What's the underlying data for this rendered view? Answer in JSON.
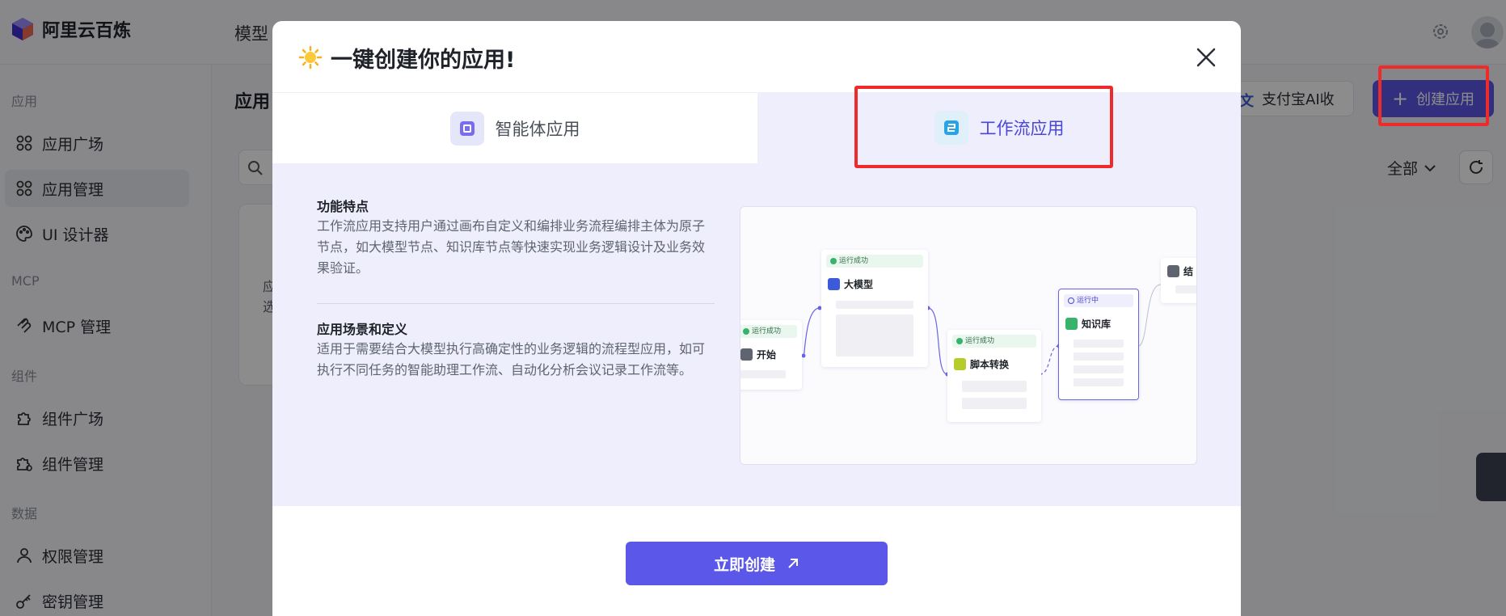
{
  "brand": {
    "name": "阿里云百炼"
  },
  "topnav": {
    "first": "模型"
  },
  "sidebar": {
    "groups": [
      "应用",
      "MCP",
      "组件",
      "数据"
    ],
    "items": [
      {
        "label": "应用广场",
        "icon": "grid-icon"
      },
      {
        "label": "应用管理",
        "icon": "grid-icon"
      },
      {
        "label": "UI 设计器",
        "icon": "palette-icon"
      },
      {
        "label": "MCP 管理",
        "icon": "mcp-icon"
      },
      {
        "label": "组件广场",
        "icon": "puzzle-icon"
      },
      {
        "label": "组件管理",
        "icon": "puzzle-gear-icon"
      },
      {
        "label": "权限管理",
        "icon": "user-icon"
      },
      {
        "label": "密钥管理",
        "icon": "key-icon"
      }
    ]
  },
  "main": {
    "title": "应用",
    "alipay_tag": "文",
    "alipay_label": "支付宝AI收",
    "create_label": "创建应用",
    "filter_label": "全部",
    "card_text": [
      "应",
      "选"
    ]
  },
  "modal": {
    "title": "一键创建你的应用!",
    "tabs": [
      {
        "label": "智能体应用",
        "active": false
      },
      {
        "label": "工作流应用",
        "active": true
      }
    ],
    "features_title": "功能特点",
    "features_desc": "工作流应用支持用户通过画布自定义和编排业务流程编排主体为原子节点，如大模型节点、知识库节点等快速实现业务逻辑设计及业务效果验证。",
    "scenario_title": "应用场景和定义",
    "scenario_desc": "适用于需要结合大模型执行高确定性的业务逻辑的流程型应用，如可执行不同任务的智能助理工作流、自动化分析会议记录工作流等。",
    "preview": {
      "nodes": [
        {
          "status": "运行成功",
          "title": "开始"
        },
        {
          "status": "运行成功",
          "title": "大模型"
        },
        {
          "status": "运行成功",
          "title": "脚本转换"
        },
        {
          "status": "运行中",
          "title": "知识库"
        },
        {
          "status": "",
          "title": "结"
        }
      ]
    },
    "submit_label": "立即创建"
  },
  "colors": {
    "accent": "#5b57e8",
    "highlight": "#ee2a2a",
    "panel": "#eeeefc"
  }
}
